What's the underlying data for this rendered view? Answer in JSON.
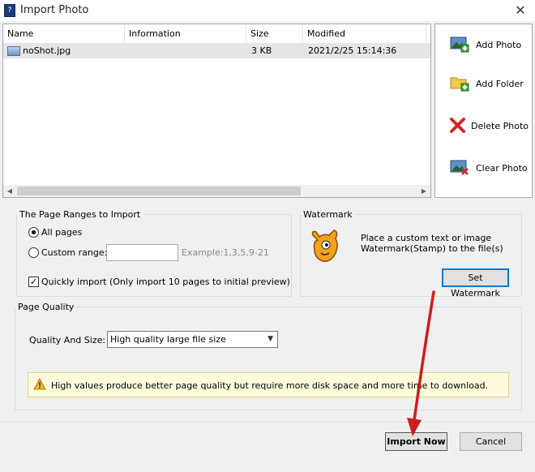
{
  "window": {
    "title": "Import Photo",
    "close_glyph": "✕"
  },
  "file_list": {
    "columns": [
      "Name",
      "Information",
      "Size",
      "Modified",
      ""
    ],
    "rows": [
      {
        "name": "noShot.jpg",
        "information": "",
        "size": "3 KB",
        "modified": "2021/2/25 15:14:36"
      }
    ]
  },
  "side_buttons": {
    "add_photo": "Add Photo",
    "add_folder": "Add Folder",
    "delete_photo": "Delete Photo",
    "clear_photo": "Clear Photo"
  },
  "page_ranges": {
    "legend": "The Page Ranges to Import",
    "all_pages": "All pages",
    "custom_range": "Custom range:",
    "custom_range_value": "",
    "example": "Example:1,3,5,9-21",
    "quick_import": "Quickly import (Only import 10 pages to  initial  preview)",
    "selected": "all_pages",
    "quick_import_checked": true
  },
  "watermark": {
    "legend": "Watermark",
    "description_line1": "Place a custom text or image",
    "description_line2": "Watermark(Stamp) to the file(s)",
    "button": "Set Watermark"
  },
  "page_quality": {
    "legend": "Page Quality",
    "label": "Quality And Size:",
    "selected": "High quality large file size"
  },
  "warning": {
    "text": "High values produce better page quality but require more disk space and more time to download."
  },
  "footer": {
    "import_now": "Import Now",
    "cancel": "Cancel"
  },
  "icons": {
    "app": "app-icon",
    "file": "image-file-icon",
    "add_photo": "add-photo-icon",
    "add_folder": "add-folder-icon",
    "delete_photo": "delete-x-icon",
    "clear_photo": "clear-photo-icon",
    "watermark": "gimp-logo-icon",
    "warning": "warning-icon"
  },
  "colors": {
    "selection_row": "#e5e5e5",
    "focus_border": "#0078d7",
    "warning_bg": "#fefbdc",
    "annotation_arrow": "#d01c1c"
  }
}
